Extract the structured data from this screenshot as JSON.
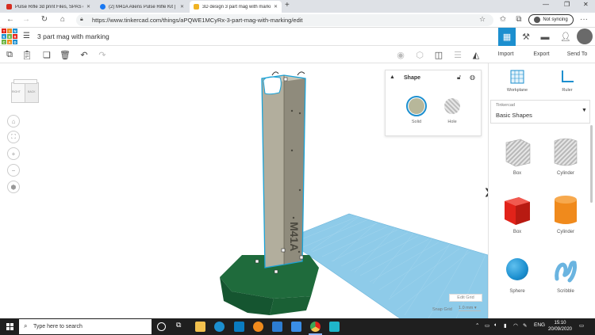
{
  "browser": {
    "tabs": [
      {
        "label": "Pulse Rifle 3d print Files, SPAS cr",
        "favicon_color": "#d62d20",
        "active": false
      },
      {
        "label": "(2) M41A Aliens Pulse Rifle Kit | F",
        "favicon_color": "#1877f2",
        "active": false
      },
      {
        "label": "3D design 3 part mag with marki",
        "favicon_color": "#f0b323",
        "active": true
      }
    ],
    "new_tab": "+",
    "url": "https://www.tinkercad.com/things/aPQWE1MCyRx-3-part-mag-with-marking/edit",
    "sync_label": "Not syncing",
    "menu": "···"
  },
  "app": {
    "logo_letters": [
      "TIN",
      "KER",
      "CAD",
      "",
      "",
      "",
      "",
      "",
      ""
    ],
    "title": "3 part mag with marking",
    "toolbar_right": {
      "import": "Import",
      "export": "Export",
      "send_to": "Send To"
    }
  },
  "viewcube": {
    "right": "RIGHT",
    "back": "BACK"
  },
  "inspector": {
    "title": "Shape",
    "solid_label": "Solid",
    "hole_label": "Hole",
    "solid_color": "#b7b79a"
  },
  "model": {
    "marking_text": "M41A",
    "body_color": "#a8a494",
    "base_color": "#1f6b3c",
    "grid_color": "#8ecbe9"
  },
  "workspace": {
    "edit_grid": "Edit Grid",
    "snap_grid_label": "Snap Grid",
    "snap_grid_value": "1.0 mm ▾"
  },
  "panel": {
    "workplane": "Workplane",
    "ruler": "Ruler",
    "library_small": "Tinkercad",
    "library_selected": "Basic Shapes",
    "shapes": [
      {
        "label": "Box",
        "color": "#c7c7c7",
        "kind": "box-hole"
      },
      {
        "label": "Cylinder",
        "color": "#c7c7c7",
        "kind": "cyl-hole"
      },
      {
        "label": "Box",
        "color": "#e2231a",
        "kind": "box"
      },
      {
        "label": "Cylinder",
        "color": "#f08a1c",
        "kind": "cyl"
      },
      {
        "label": "Sphere",
        "color": "#1c8fcf",
        "kind": "sphere"
      },
      {
        "label": "Scribble",
        "color": "#6ab4e0",
        "kind": "scribble"
      }
    ]
  },
  "taskbar": {
    "search_placeholder": "Type here to search",
    "language": "ENG",
    "time": "15:10",
    "date": "20/09/2020"
  }
}
